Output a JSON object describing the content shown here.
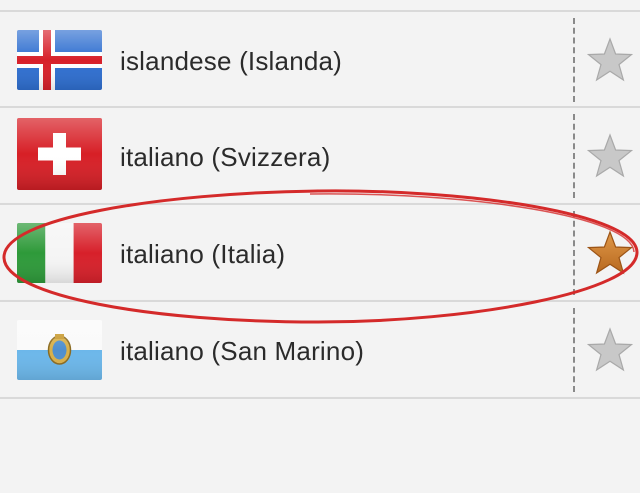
{
  "languages": [
    {
      "label": "islandese (Islanda)",
      "flag": "iceland-flag-icon",
      "favorite": false
    },
    {
      "label": "italiano (Svizzera)",
      "flag": "switzerland-flag-icon",
      "favorite": false
    },
    {
      "label": "italiano (Italia)",
      "flag": "italy-flag-icon",
      "favorite": true
    },
    {
      "label": "italiano (San Marino)",
      "flag": "san-marino-flag-icon",
      "favorite": false
    }
  ],
  "colors": {
    "star_inactive": "#c8c8c8",
    "star_active": "#c87d32",
    "highlight_ellipse": "#d42a2a",
    "row_background": "#f3f3f3"
  }
}
